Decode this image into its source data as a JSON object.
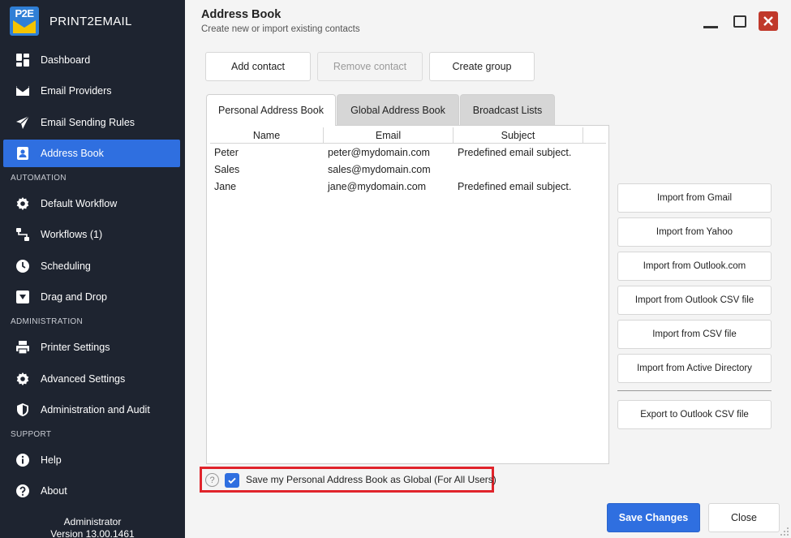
{
  "app": {
    "brand_logo_text": "P2E",
    "brand_name": "PRINT2EMAIL"
  },
  "sidebar": {
    "items": [
      {
        "label": "Dashboard",
        "icon": "dashboard-icon"
      },
      {
        "label": "Email Providers",
        "icon": "envelope-icon"
      },
      {
        "label": "Email Sending Rules",
        "icon": "paper-plane-icon"
      },
      {
        "label": "Address Book",
        "icon": "contact-card-icon",
        "active": true
      },
      {
        "label": "Default Workflow",
        "icon": "gear-icon"
      },
      {
        "label": "Workflows (1)",
        "icon": "workflow-icon"
      },
      {
        "label": "Scheduling",
        "icon": "clock-icon"
      },
      {
        "label": "Drag and Drop",
        "icon": "drop-icon"
      },
      {
        "label": "Printer Settings",
        "icon": "printer-icon"
      },
      {
        "label": "Advanced Settings",
        "icon": "gear-icon"
      },
      {
        "label": "Administration and Audit",
        "icon": "shield-icon"
      },
      {
        "label": "Help",
        "icon": "info-icon"
      },
      {
        "label": "About",
        "icon": "question-icon"
      }
    ],
    "sections": {
      "automation": "AUTOMATION",
      "administration": "ADMINISTRATION",
      "support": "SUPPORT"
    },
    "user": {
      "name": "Administrator",
      "version": "Version 13.00.1461"
    }
  },
  "header": {
    "title": "Address Book",
    "subtitle": "Create new or import existing contacts"
  },
  "toolbar": {
    "add_label": "Add contact",
    "remove_label": "Remove contact",
    "group_label": "Create group"
  },
  "tabs": [
    {
      "label": "Personal Address Book",
      "active": true
    },
    {
      "label": "Global Address Book",
      "active": false
    },
    {
      "label": "Broadcast Lists",
      "active": false
    }
  ],
  "table": {
    "columns": [
      "Name",
      "Email",
      "Subject"
    ],
    "rows": [
      {
        "name": "Peter",
        "email": "peter@mydomain.com",
        "subject": "Predefined email subject."
      },
      {
        "name": "Sales",
        "email": "sales@mydomain.com",
        "subject": ""
      },
      {
        "name": "Jane",
        "email": "jane@mydomain.com",
        "subject": "Predefined email subject."
      }
    ]
  },
  "imports": {
    "gmail": "Import from Gmail",
    "yahoo": "Import from Yahoo",
    "outlook_com": "Import from Outlook.com",
    "outlook_csv": "Import from Outlook CSV file",
    "csv": "Import from CSV file",
    "active_directory": "Import from Active Directory",
    "export_outlook_csv": "Export to Outlook CSV file"
  },
  "options": {
    "help_glyph": "?",
    "save_global_label": "Save my Personal Address Book as Global (For All Users)",
    "save_global_checked": true
  },
  "footer": {
    "save_label": "Save Changes",
    "close_label": "Close"
  },
  "colors": {
    "sidebar_bg": "#1e2430",
    "accent": "#2f6fe0",
    "highlight_border": "#e0242b",
    "close_red": "#c0392b"
  }
}
